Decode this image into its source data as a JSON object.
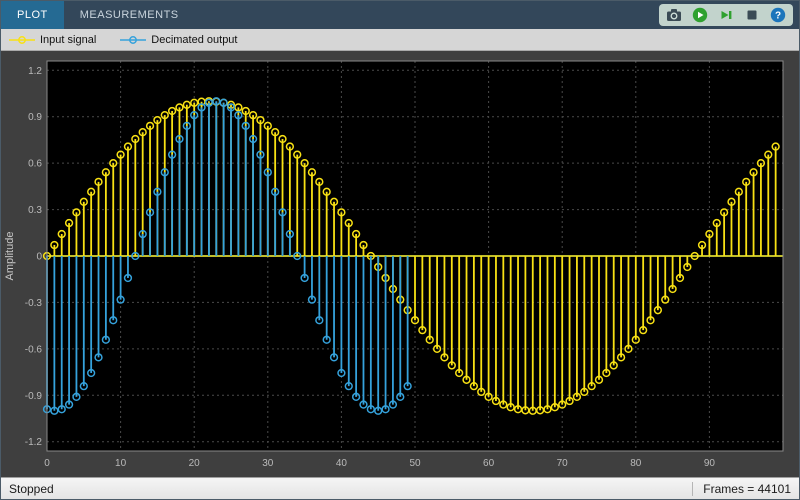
{
  "toolstrip": {
    "tabs": [
      {
        "label": "PLOT",
        "active": true
      },
      {
        "label": "MEASUREMENTS",
        "active": false
      }
    ],
    "buttons": [
      {
        "name": "snapshot-button",
        "icon": "camera-icon"
      },
      {
        "name": "run-button",
        "icon": "play-icon"
      },
      {
        "name": "step-forward-button",
        "icon": "step-forward-icon"
      },
      {
        "name": "stop-button",
        "icon": "stop-icon"
      },
      {
        "name": "help-button",
        "icon": "question-icon"
      }
    ],
    "help_glyph": "?"
  },
  "legend": {
    "items": [
      {
        "label": "Input signal",
        "color": "#f8e114"
      },
      {
        "label": "Decimated output",
        "color": "#35a2dc"
      }
    ]
  },
  "status_bar": {
    "left": "Stopped",
    "right": "Frames = 44101"
  },
  "chart_data": {
    "type": "stem",
    "title": "",
    "xlabel": "",
    "ylabel": "Amplitude",
    "xlim": [
      0,
      100
    ],
    "ylim": [
      -1.26,
      1.26
    ],
    "x_ticks": [
      0,
      10,
      20,
      30,
      40,
      50,
      60,
      70,
      80,
      90
    ],
    "y_ticks": [
      -1.2,
      -0.9,
      -0.6,
      -0.3,
      0,
      0.3,
      0.6,
      0.9,
      1.2
    ],
    "grid": true,
    "background": "#000000",
    "grid_color": "#4a4a4a",
    "tick_color": "#bababa",
    "series": [
      {
        "name": "Input signal",
        "color": "#f8e114",
        "x_start": 0,
        "x_step": 1,
        "values": [
          0,
          0.071,
          0.142,
          0.213,
          0.282,
          0.35,
          0.415,
          0.479,
          0.541,
          0.6,
          0.655,
          0.707,
          0.756,
          0.8,
          0.841,
          0.878,
          0.91,
          0.937,
          0.96,
          0.977,
          0.99,
          0.997,
          1,
          0.997,
          0.99,
          0.977,
          0.96,
          0.937,
          0.91,
          0.878,
          0.841,
          0.8,
          0.756,
          0.707,
          0.655,
          0.6,
          0.541,
          0.479,
          0.415,
          0.35,
          0.282,
          0.213,
          0.142,
          0.071,
          0,
          -0.071,
          -0.142,
          -0.213,
          -0.282,
          -0.35,
          -0.415,
          -0.479,
          -0.541,
          -0.6,
          -0.655,
          -0.707,
          -0.756,
          -0.8,
          -0.841,
          -0.878,
          -0.91,
          -0.937,
          -0.96,
          -0.977,
          -0.99,
          -0.997,
          -1,
          -0.997,
          -0.99,
          -0.977,
          -0.96,
          -0.937,
          -0.91,
          -0.878,
          -0.841,
          -0.8,
          -0.756,
          -0.707,
          -0.655,
          -0.6,
          -0.541,
          -0.479,
          -0.415,
          -0.35,
          -0.282,
          -0.213,
          -0.142,
          -0.071,
          0,
          0.071,
          0.142,
          0.213,
          0.282,
          0.35,
          0.415,
          0.479,
          0.541,
          0.6,
          0.655,
          0.707
        ]
      },
      {
        "name": "Decimated output",
        "color": "#35a2dc",
        "x_start": 0,
        "x_step": 1,
        "values": [
          -0.99,
          -1,
          -0.99,
          -0.96,
          -0.91,
          -0.841,
          -0.756,
          -0.655,
          -0.541,
          -0.415,
          -0.282,
          -0.142,
          0,
          0.142,
          0.282,
          0.415,
          0.541,
          0.655,
          0.756,
          0.841,
          0.91,
          0.96,
          0.99,
          1,
          0.99,
          0.96,
          0.91,
          0.841,
          0.756,
          0.655,
          0.541,
          0.415,
          0.282,
          0.142,
          0,
          -0.142,
          -0.282,
          -0.415,
          -0.541,
          -0.655,
          -0.756,
          -0.841,
          -0.91,
          -0.96,
          -0.99,
          -1,
          -0.99,
          -0.96,
          -0.91,
          -0.841
        ]
      }
    ]
  }
}
